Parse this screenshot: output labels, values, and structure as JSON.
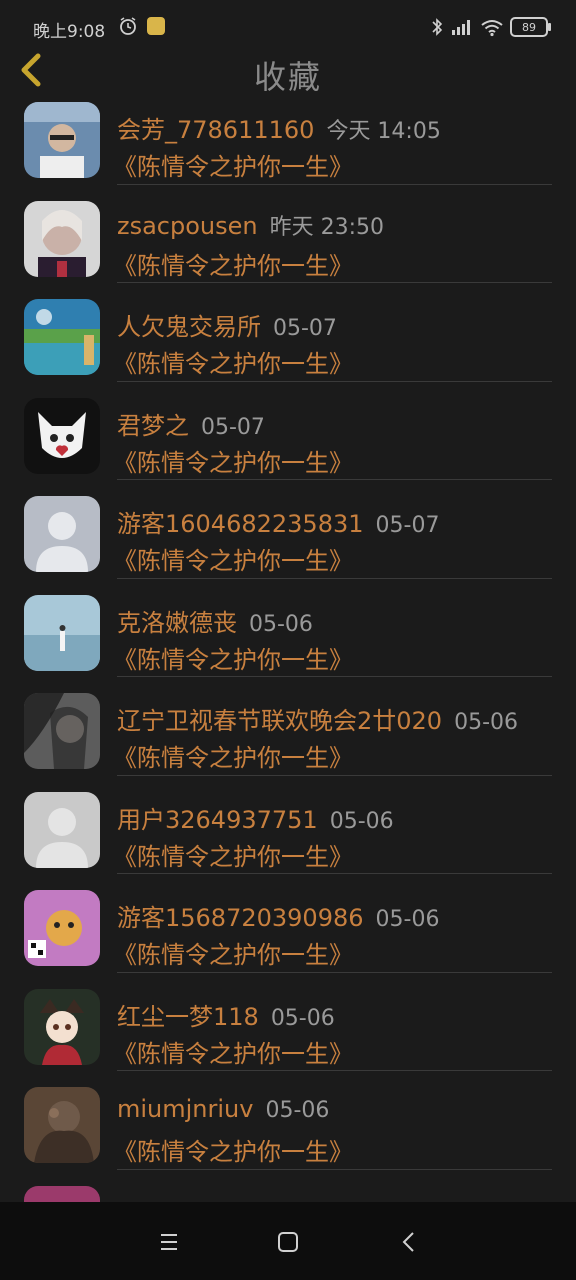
{
  "status": {
    "time": "晚上9:08",
    "battery": "89"
  },
  "header": {
    "title": "收藏"
  },
  "list": [
    {
      "user": "会芳_778611160",
      "time": "今天 14:05",
      "title": "《陈情令之护你一生》",
      "avatar_color": "#6b8cae"
    },
    {
      "user": "zsacpousen",
      "time": "昨天 23:50",
      "title": "《陈情令之护你一生》",
      "avatar_color": "#8a6f7a"
    },
    {
      "user": "人欠鬼交易所",
      "time": "05-07",
      "title": "《陈情令之护你一生》",
      "avatar_color": "#3f8f9a"
    },
    {
      "user": "君梦之",
      "time": "05-07",
      "title": "《陈情令之护你一生》",
      "avatar_color": "#222222"
    },
    {
      "user": "游客1604682235831",
      "time": "05-07",
      "title": "《陈情令之护你一生》",
      "avatar_color": "#b7bcc6"
    },
    {
      "user": "克洛嫩德丧",
      "time": "05-06",
      "title": "《陈情令之护你一生》",
      "avatar_color": "#8fb3c4"
    },
    {
      "user": "辽宁卫视春节联欢晚会2廿020",
      "time": "05-06",
      "title": "《陈情令之护你一生》",
      "avatar_color": "#6e6e6e"
    },
    {
      "user": "用户3264937751",
      "time": "05-06",
      "title": "《陈情令之护你一生》",
      "avatar_color": "#c9c9c9"
    },
    {
      "user": "游客1568720390986",
      "time": "05-06",
      "title": "《陈情令之护你一生》",
      "avatar_color": "#c27bc2"
    },
    {
      "user": "红尘一梦118",
      "time": "05-06",
      "title": "《陈情令之护你一生》",
      "avatar_color": "#2f3a2f"
    },
    {
      "user": "miumjnriuv",
      "time": "05-06",
      "title": "《陈情令之护你一生》",
      "avatar_color": "#6a5240"
    }
  ],
  "partial": {
    "avatar_color": "#9b3a6b"
  }
}
